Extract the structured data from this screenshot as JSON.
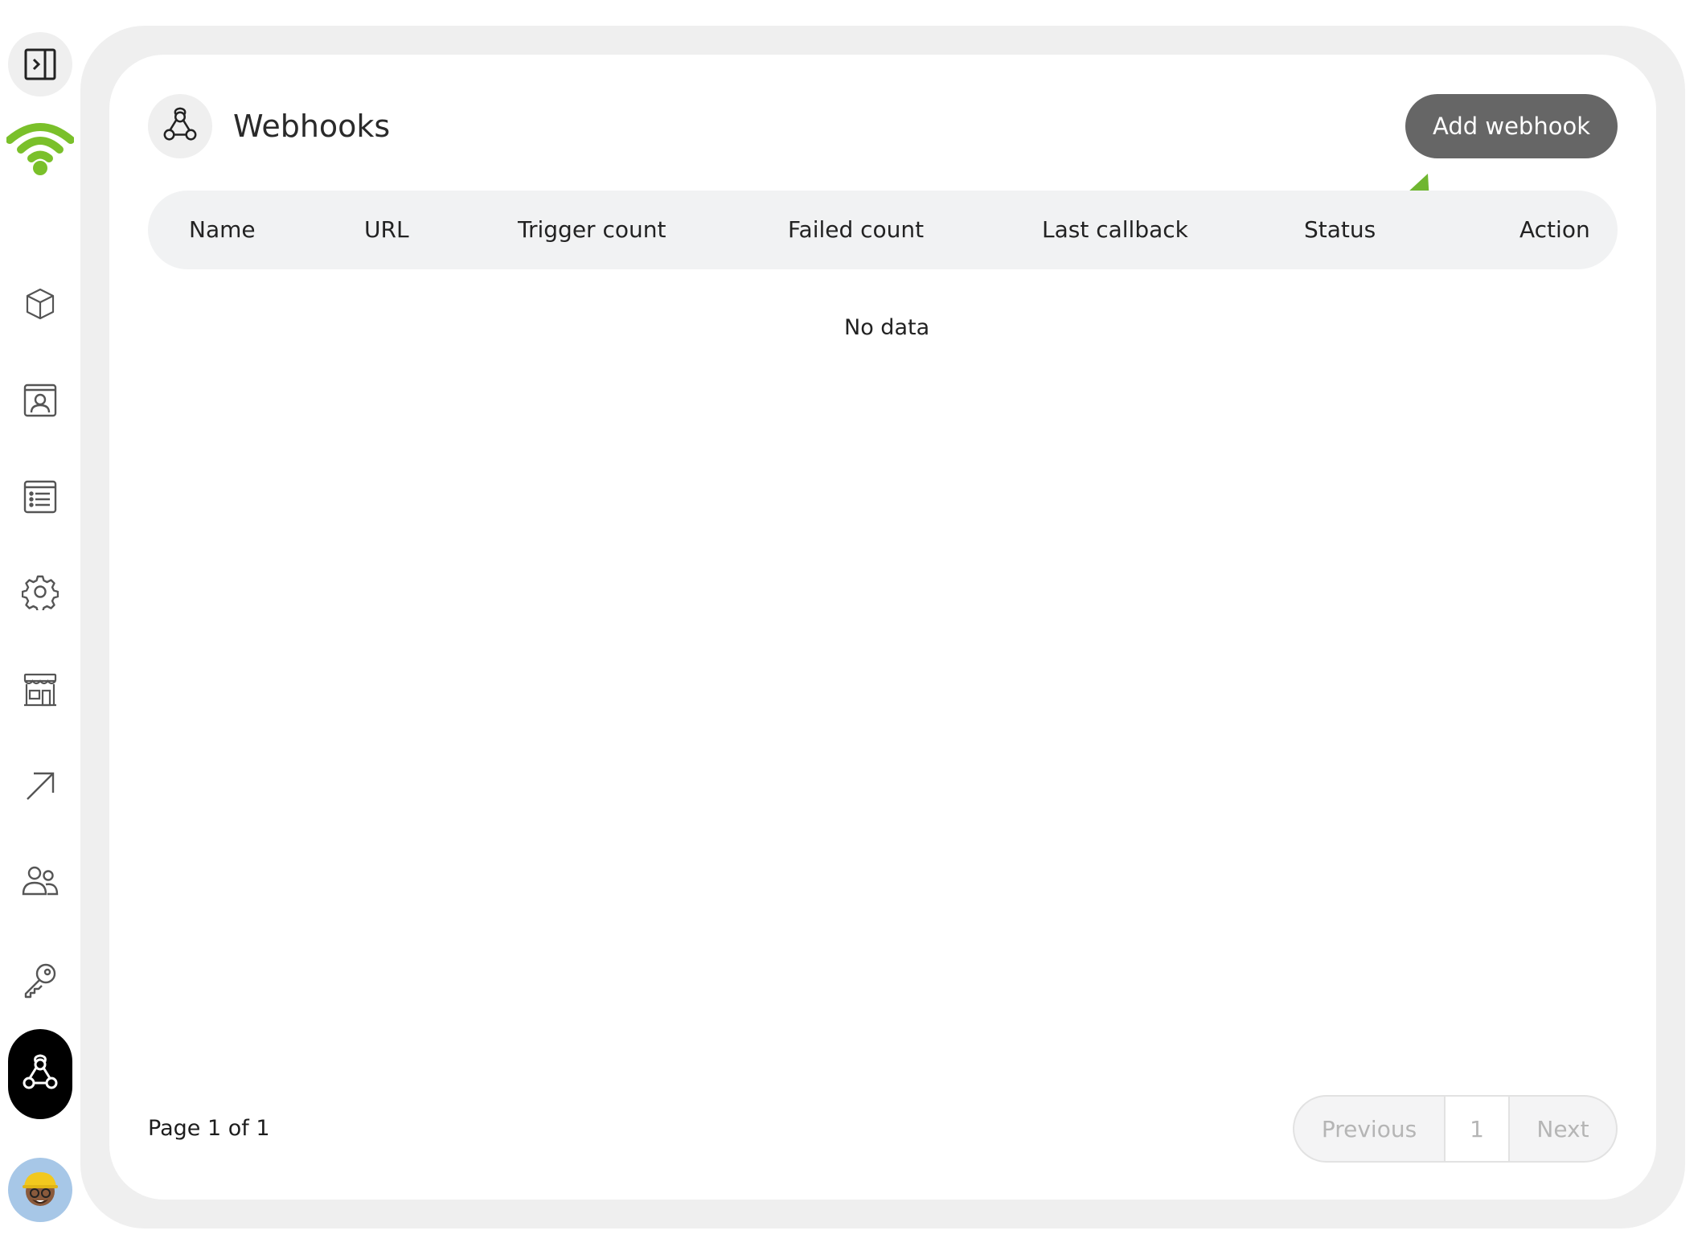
{
  "sidebar": {
    "toggle_icon": "sidebar-toggle-icon",
    "logo_icon": "wifi-logo-icon",
    "logo_color": "#7ac02a",
    "nav_items": [
      {
        "icon": "cube-icon"
      },
      {
        "icon": "contact-card-icon"
      },
      {
        "icon": "list-icon"
      },
      {
        "icon": "gear-icon"
      },
      {
        "icon": "storefront-icon"
      },
      {
        "icon": "arrow-up-right-icon"
      },
      {
        "icon": "users-icon"
      },
      {
        "icon": "key-icon"
      },
      {
        "icon": "webhook-icon",
        "active": true
      }
    ],
    "avatar_icon": "user-avatar"
  },
  "header": {
    "icon": "webhook-icon",
    "title": "Webhooks",
    "add_button_label": "Add webhook",
    "add_button_color": "#666666"
  },
  "annotation": {
    "icon": "green-arrow-icon",
    "color": "#6fb630"
  },
  "table": {
    "columns": [
      "Name",
      "URL",
      "Trigger count",
      "Failed count",
      "Last callback",
      "Status",
      "Action"
    ],
    "rows": [],
    "empty_text": "No data"
  },
  "footer": {
    "page_info": "Page 1 of 1",
    "pagination": {
      "previous_label": "Previous",
      "current_page": "1",
      "next_label": "Next"
    }
  }
}
